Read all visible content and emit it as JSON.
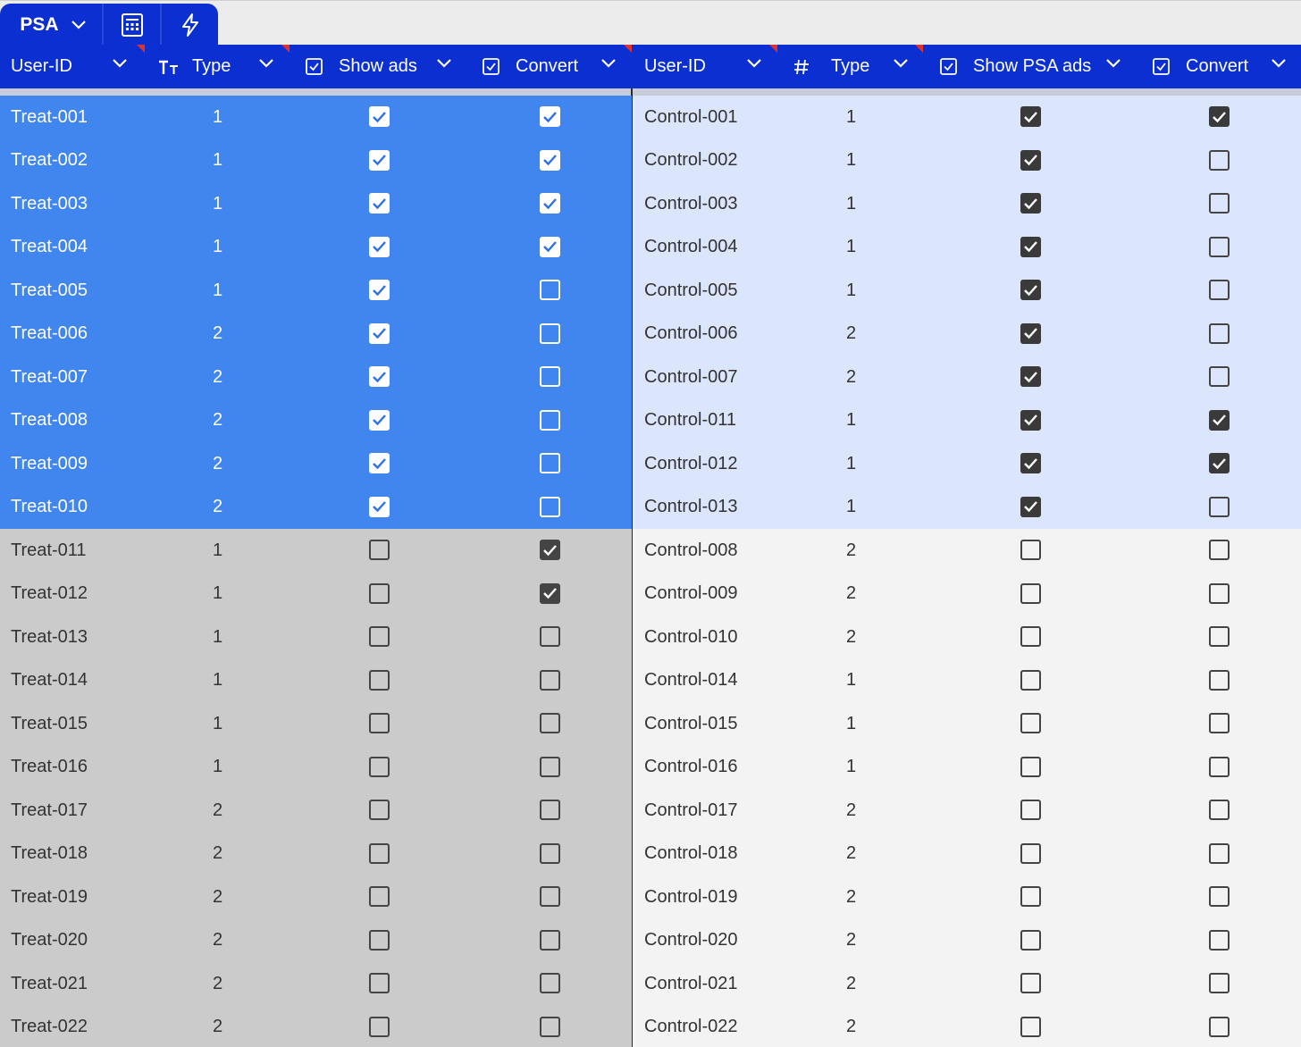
{
  "tabs": {
    "view_label": "PSA",
    "icons": [
      "calculator-icon",
      "lightning-icon"
    ]
  },
  "colors": {
    "header_bg": "#0b2fd1",
    "selected_left": "#4185ef",
    "selected_right": "#dbe6fd",
    "unselected_left": "#cbcbcb",
    "unselected_right": "#f3f3f3"
  },
  "left_table": {
    "columns": {
      "user_id": "User-ID",
      "type": "Type",
      "show_ads": "Show ads",
      "convert": "Convert"
    },
    "rows": [
      {
        "id": "Treat-001",
        "type": "1",
        "show": true,
        "convert": true,
        "selected": true
      },
      {
        "id": "Treat-002",
        "type": "1",
        "show": true,
        "convert": true,
        "selected": true
      },
      {
        "id": "Treat-003",
        "type": "1",
        "show": true,
        "convert": true,
        "selected": true
      },
      {
        "id": "Treat-004",
        "type": "1",
        "show": true,
        "convert": true,
        "selected": true
      },
      {
        "id": "Treat-005",
        "type": "1",
        "show": true,
        "convert": false,
        "selected": true
      },
      {
        "id": "Treat-006",
        "type": "2",
        "show": true,
        "convert": false,
        "selected": true
      },
      {
        "id": "Treat-007",
        "type": "2",
        "show": true,
        "convert": false,
        "selected": true
      },
      {
        "id": "Treat-008",
        "type": "2",
        "show": true,
        "convert": false,
        "selected": true
      },
      {
        "id": "Treat-009",
        "type": "2",
        "show": true,
        "convert": false,
        "selected": true
      },
      {
        "id": "Treat-010",
        "type": "2",
        "show": true,
        "convert": false,
        "selected": true
      },
      {
        "id": "Treat-011",
        "type": "1",
        "show": false,
        "convert": true,
        "selected": false
      },
      {
        "id": "Treat-012",
        "type": "1",
        "show": false,
        "convert": true,
        "selected": false
      },
      {
        "id": "Treat-013",
        "type": "1",
        "show": false,
        "convert": false,
        "selected": false
      },
      {
        "id": "Treat-014",
        "type": "1",
        "show": false,
        "convert": false,
        "selected": false
      },
      {
        "id": "Treat-015",
        "type": "1",
        "show": false,
        "convert": false,
        "selected": false
      },
      {
        "id": "Treat-016",
        "type": "1",
        "show": false,
        "convert": false,
        "selected": false
      },
      {
        "id": "Treat-017",
        "type": "2",
        "show": false,
        "convert": false,
        "selected": false
      },
      {
        "id": "Treat-018",
        "type": "2",
        "show": false,
        "convert": false,
        "selected": false
      },
      {
        "id": "Treat-019",
        "type": "2",
        "show": false,
        "convert": false,
        "selected": false
      },
      {
        "id": "Treat-020",
        "type": "2",
        "show": false,
        "convert": false,
        "selected": false
      },
      {
        "id": "Treat-021",
        "type": "2",
        "show": false,
        "convert": false,
        "selected": false
      },
      {
        "id": "Treat-022",
        "type": "2",
        "show": false,
        "convert": false,
        "selected": false
      }
    ]
  },
  "right_table": {
    "columns": {
      "user_id": "User-ID",
      "type": "Type",
      "show_ads": "Show PSA ads",
      "convert": "Convert"
    },
    "rows": [
      {
        "id": "Control-001",
        "type": "1",
        "show": true,
        "convert": true,
        "selected": true
      },
      {
        "id": "Control-002",
        "type": "1",
        "show": true,
        "convert": false,
        "selected": true
      },
      {
        "id": "Control-003",
        "type": "1",
        "show": true,
        "convert": false,
        "selected": true
      },
      {
        "id": "Control-004",
        "type": "1",
        "show": true,
        "convert": false,
        "selected": true
      },
      {
        "id": "Control-005",
        "type": "1",
        "show": true,
        "convert": false,
        "selected": true
      },
      {
        "id": "Control-006",
        "type": "2",
        "show": true,
        "convert": false,
        "selected": true
      },
      {
        "id": "Control-007",
        "type": "2",
        "show": true,
        "convert": false,
        "selected": true
      },
      {
        "id": "Control-011",
        "type": "1",
        "show": true,
        "convert": true,
        "selected": true
      },
      {
        "id": "Control-012",
        "type": "1",
        "show": true,
        "convert": true,
        "selected": true
      },
      {
        "id": "Control-013",
        "type": "1",
        "show": true,
        "convert": false,
        "selected": true
      },
      {
        "id": "Control-008",
        "type": "2",
        "show": false,
        "convert": false,
        "selected": false
      },
      {
        "id": "Control-009",
        "type": "2",
        "show": false,
        "convert": false,
        "selected": false
      },
      {
        "id": "Control-010",
        "type": "2",
        "show": false,
        "convert": false,
        "selected": false
      },
      {
        "id": "Control-014",
        "type": "1",
        "show": false,
        "convert": false,
        "selected": false
      },
      {
        "id": "Control-015",
        "type": "1",
        "show": false,
        "convert": false,
        "selected": false
      },
      {
        "id": "Control-016",
        "type": "1",
        "show": false,
        "convert": false,
        "selected": false
      },
      {
        "id": "Control-017",
        "type": "2",
        "show": false,
        "convert": false,
        "selected": false
      },
      {
        "id": "Control-018",
        "type": "2",
        "show": false,
        "convert": false,
        "selected": false
      },
      {
        "id": "Control-019",
        "type": "2",
        "show": false,
        "convert": false,
        "selected": false
      },
      {
        "id": "Control-020",
        "type": "2",
        "show": false,
        "convert": false,
        "selected": false
      },
      {
        "id": "Control-021",
        "type": "2",
        "show": false,
        "convert": false,
        "selected": false
      },
      {
        "id": "Control-022",
        "type": "2",
        "show": false,
        "convert": false,
        "selected": false
      }
    ]
  }
}
